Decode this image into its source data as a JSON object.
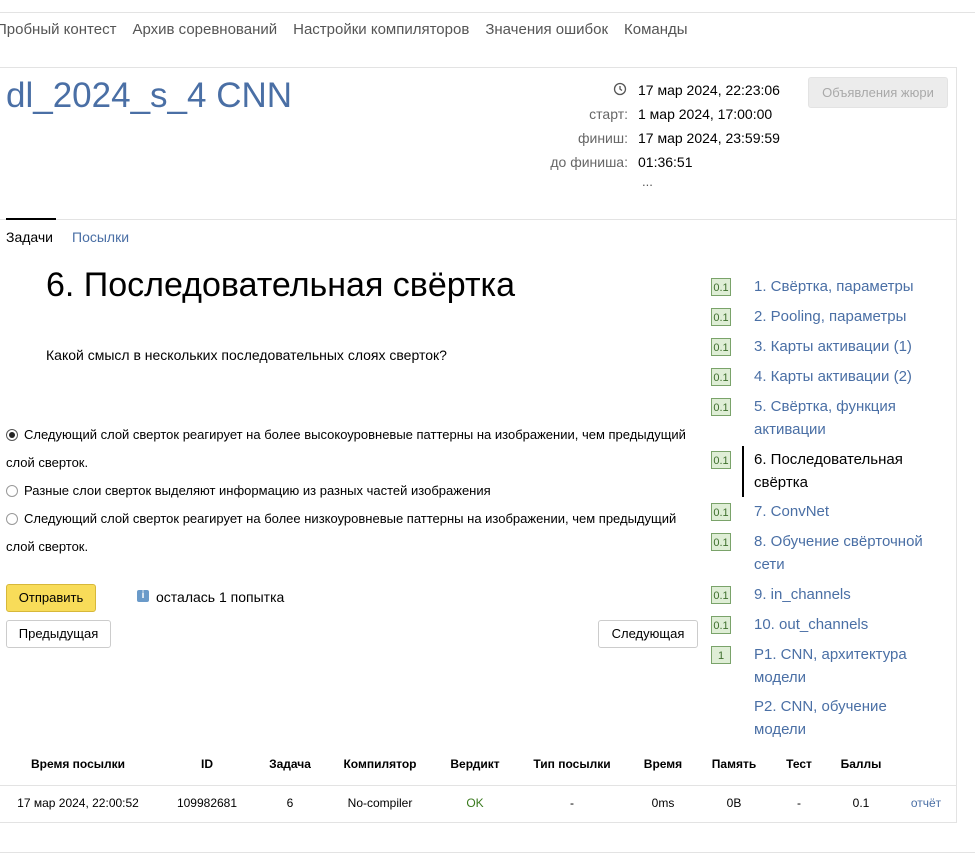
{
  "topnav": {
    "items": [
      "Пробный контест",
      "Архив соревнований",
      "Настройки компиляторов",
      "Значения ошибок",
      "Команды"
    ]
  },
  "contest": {
    "title": "dl_2024_s_4 CNN",
    "now": "17 мар 2024, 22:23:06",
    "start_label": "старт:",
    "start": "1 мар 2024, 17:00:00",
    "finish_label": "финиш:",
    "finish": "17 мар 2024, 23:59:59",
    "left_label": "до финиша:",
    "left": "01:36:51",
    "more": "...",
    "jury_button": "Объявления жюри"
  },
  "tabs": {
    "problems": "Задачи",
    "submissions": "Посылки"
  },
  "problem": {
    "title": "6. Последовательная свёртка",
    "question": "Какой смысл в нескольких последовательных слоях сверток?",
    "options": [
      "Следующий слой сверток реагирует на более высокоуровневые паттерны на изображении, чем предыдущий слой сверток.",
      "Разные слои сверток выделяют информацию из разных частей изображения",
      "Следующий слой сверток реагирует на более низкоуровневые паттерны на изображении, чем предыдущий слой сверток."
    ],
    "selected_option": 0,
    "submit": "Отправить",
    "attempts_icon": "i",
    "attempts": "осталась 1 попытка",
    "prev": "Предыдущая",
    "next": "Следующая"
  },
  "sidebar": {
    "items": [
      {
        "badge": "0.1",
        "label": "1. Свёртка, параметры"
      },
      {
        "badge": "0.1",
        "label": "2. Pooling, параметры"
      },
      {
        "badge": "0.1",
        "label": "3. Карты активации (1)"
      },
      {
        "badge": "0.1",
        "label": "4. Карты активации (2)"
      },
      {
        "badge": "0.1",
        "label": "5. Свёртка, функция активации"
      },
      {
        "badge": "0.1",
        "label": "6. Последовательная свёртка"
      },
      {
        "badge": "0.1",
        "label": "7. ConvNet"
      },
      {
        "badge": "0.1",
        "label": "8. Обучение свёрточной сети"
      },
      {
        "badge": "0.1",
        "label": "9. in_channels"
      },
      {
        "badge": "0.1",
        "label": "10. out_channels"
      },
      {
        "badge": "1",
        "label": "P1. CNN, архитектура модели"
      },
      {
        "badge": "",
        "label": "P2. CNN, обучение модели"
      }
    ]
  },
  "table": {
    "headers": [
      "Время посылки",
      "ID",
      "Задача",
      "Компилятор",
      "Вердикт",
      "Тип посылки",
      "Время",
      "Память",
      "Тест",
      "Баллы"
    ],
    "rows": [
      {
        "time": "17 мар 2024, 22:00:52",
        "id": "109982681",
        "problem": "6",
        "compiler": "No-compiler",
        "verdict": "OK",
        "type": "-",
        "runtime": "0ms",
        "memory": "0B",
        "test": "-",
        "score": "0.1",
        "report": "отчёт"
      }
    ]
  },
  "colors": {
    "link": "#4a6fa5",
    "accent_button": "#f8dc59",
    "ok": "#3a7a1e"
  }
}
